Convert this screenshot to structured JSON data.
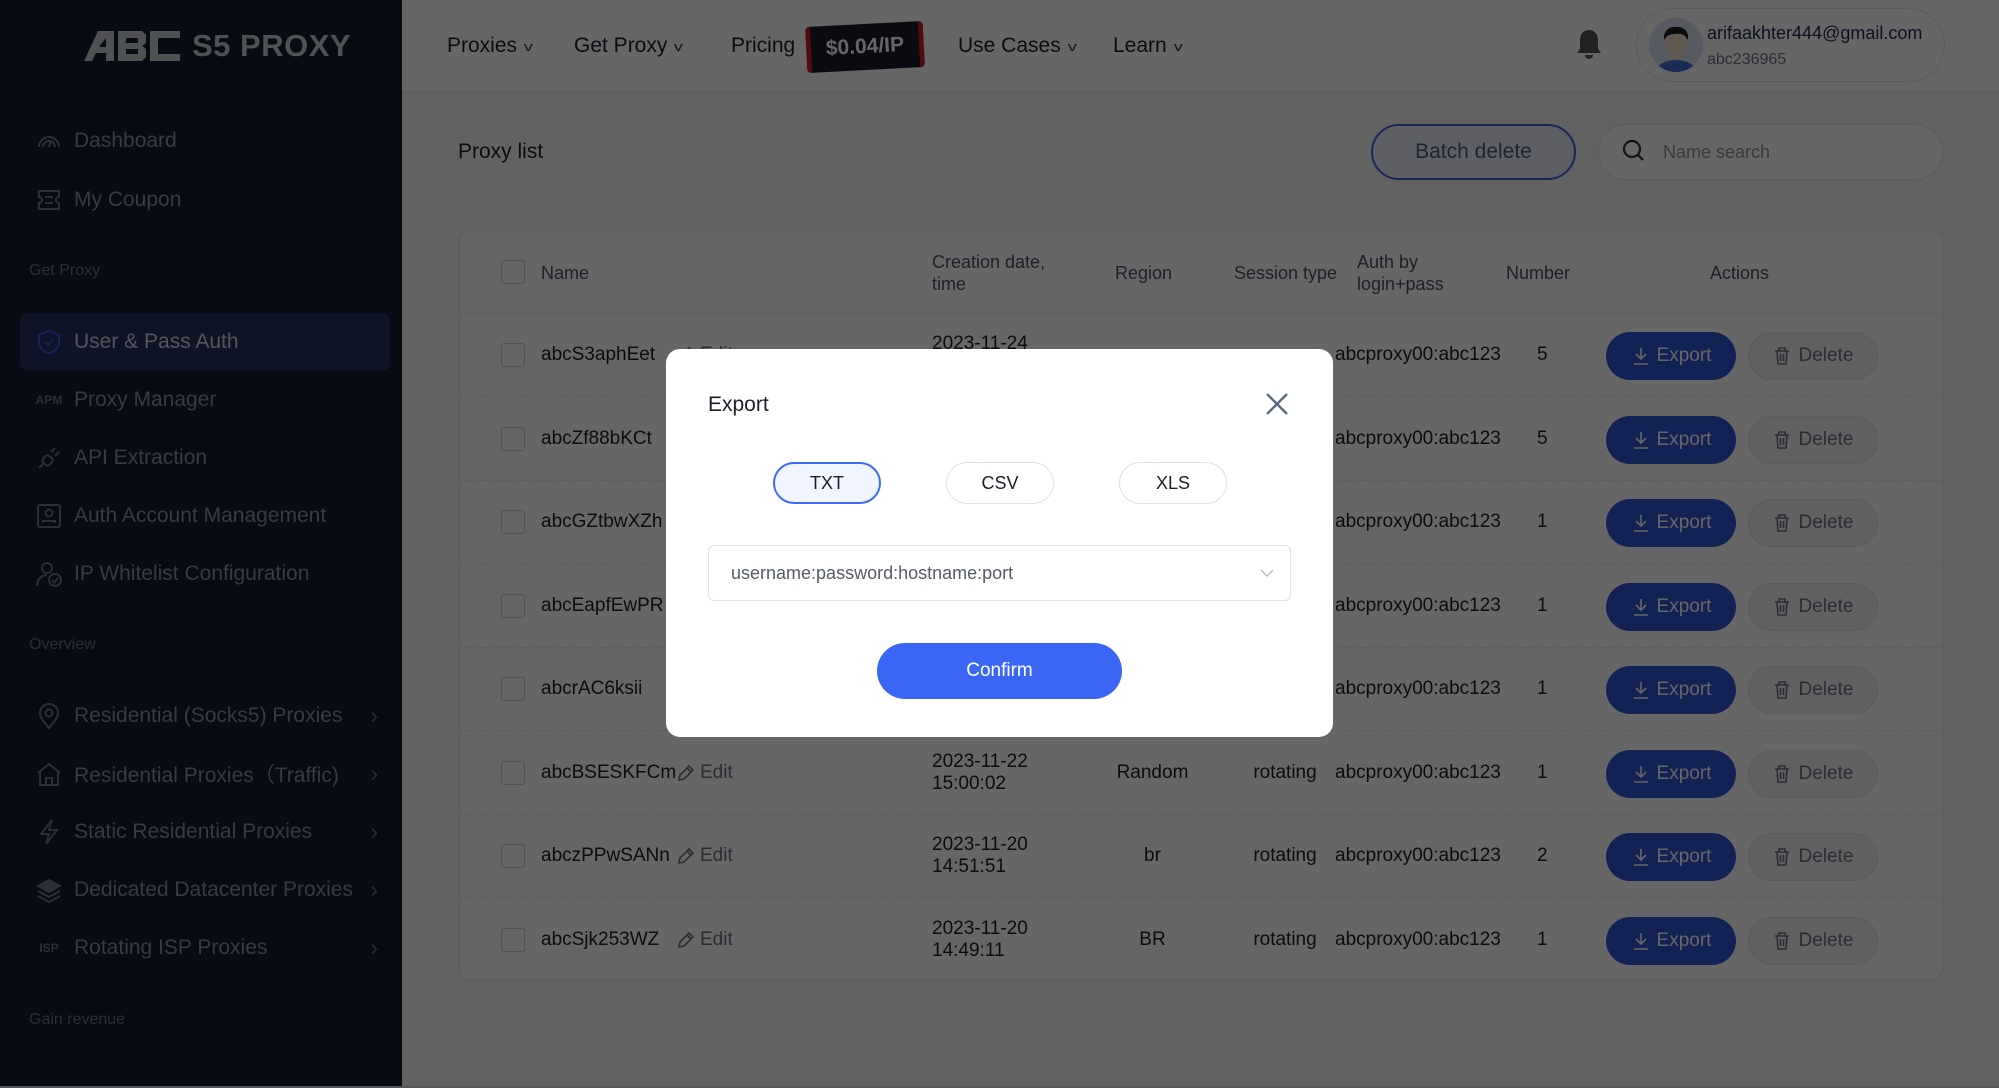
{
  "brand": {
    "logo_mark": "ABC",
    "logo_text": "S5 PROXY"
  },
  "sidebar": {
    "top_items": [
      {
        "label": "Dashboard",
        "icon": "gauge-icon"
      },
      {
        "label": "My Coupon",
        "icon": "ticket-icon"
      }
    ],
    "sections": {
      "get_proxy": "Get Proxy",
      "overview": "Overview",
      "gain_revenue": "Gain revenue"
    },
    "get_proxy_items": [
      {
        "label": "User & Pass Auth",
        "icon": "shield-check-icon",
        "active": true
      },
      {
        "label": "Proxy Manager",
        "icon_text": "APM"
      },
      {
        "label": "API Extraction",
        "icon": "plug-icon"
      },
      {
        "label": "Auth Account Management",
        "icon": "user-card-icon"
      },
      {
        "label": "IP Whitelist Configuration",
        "icon": "user-check-icon"
      }
    ],
    "overview_items": [
      {
        "label": "Residential (Socks5) Proxies",
        "icon": "location-pin-icon"
      },
      {
        "label": "Residential Proxies（Traffic)",
        "icon": "house-icon"
      },
      {
        "label": "Static Residential Proxies",
        "icon": "lightning-icon"
      },
      {
        "label": "Dedicated Datacenter Proxies",
        "icon": "layers-icon"
      },
      {
        "label": "Rotating ISP Proxies",
        "icon_text": "ISP"
      }
    ]
  },
  "header": {
    "nav": [
      {
        "label": "Proxies",
        "has_caret": true
      },
      {
        "label": "Get Proxy",
        "has_caret": true
      },
      {
        "label": "Pricing",
        "has_caret": false
      },
      {
        "label": "Use Cases",
        "has_caret": true
      },
      {
        "label": "Learn",
        "has_caret": true
      }
    ],
    "price_badge": "$0.04/IP",
    "user": {
      "email": "arifaakhter444@gmail.com",
      "id": "abc236965"
    }
  },
  "main": {
    "title": "Proxy list",
    "batch_delete": "Batch delete",
    "search_placeholder": "Name search",
    "table": {
      "headers": {
        "name": "Name",
        "created_line1": "Creation date,",
        "created_line2": "time",
        "region": "Region",
        "session": "Session type",
        "auth_line1": "Auth by",
        "auth_line2": "login+pass",
        "number": "Number",
        "actions": "Actions"
      },
      "edit_label": "Edit",
      "export_label": "Export",
      "delete_label": "Delete",
      "rows": [
        {
          "name": "abcS3aphEet",
          "date": "2023-11-24",
          "time": "",
          "region": "",
          "session": "",
          "auth": "abcproxy00:abc123",
          "number": "5"
        },
        {
          "name": "abcZf88bKCt",
          "date": "",
          "time": "",
          "region": "",
          "session": "",
          "auth": "abcproxy00:abc123",
          "number": "5"
        },
        {
          "name": "abcGZtbwXZh",
          "date": "",
          "time": "",
          "region": "",
          "session": "",
          "auth": "abcproxy00:abc123",
          "number": "1"
        },
        {
          "name": "abcEapfEwPR",
          "date": "",
          "time": "",
          "region": "",
          "session": "",
          "auth": "abcproxy00:abc123",
          "number": "1"
        },
        {
          "name": "abcrAC6ksii",
          "date": "",
          "time": "",
          "region": "",
          "session": "",
          "auth": "abcproxy00:abc123",
          "number": "1"
        },
        {
          "name": "abcBSESKFCm",
          "date": "2023-11-22",
          "time": "15:00:02",
          "region": "Random",
          "session": "rotating",
          "auth": "abcproxy00:abc123",
          "number": "1"
        },
        {
          "name": "abczPPwSANn",
          "date": "2023-11-20",
          "time": "14:51:51",
          "region": "br",
          "session": "rotating",
          "auth": "abcproxy00:abc123",
          "number": "2"
        },
        {
          "name": "abcSjk253WZ",
          "date": "2023-11-20",
          "time": "14:49:11",
          "region": "BR",
          "session": "rotating",
          "auth": "abcproxy00:abc123",
          "number": "1"
        }
      ]
    }
  },
  "modal": {
    "title": "Export",
    "formats": [
      {
        "label": "TXT",
        "selected": true
      },
      {
        "label": "CSV",
        "selected": false
      },
      {
        "label": "XLS",
        "selected": false
      }
    ],
    "format_select_value": "username:password:hostname:port",
    "confirm": "Confirm"
  },
  "colors": {
    "sidebar_bg": "#141b33",
    "accent_blue": "#3b66f5",
    "export_button": "#2f55d4",
    "active_item_bg": "#23325c"
  }
}
